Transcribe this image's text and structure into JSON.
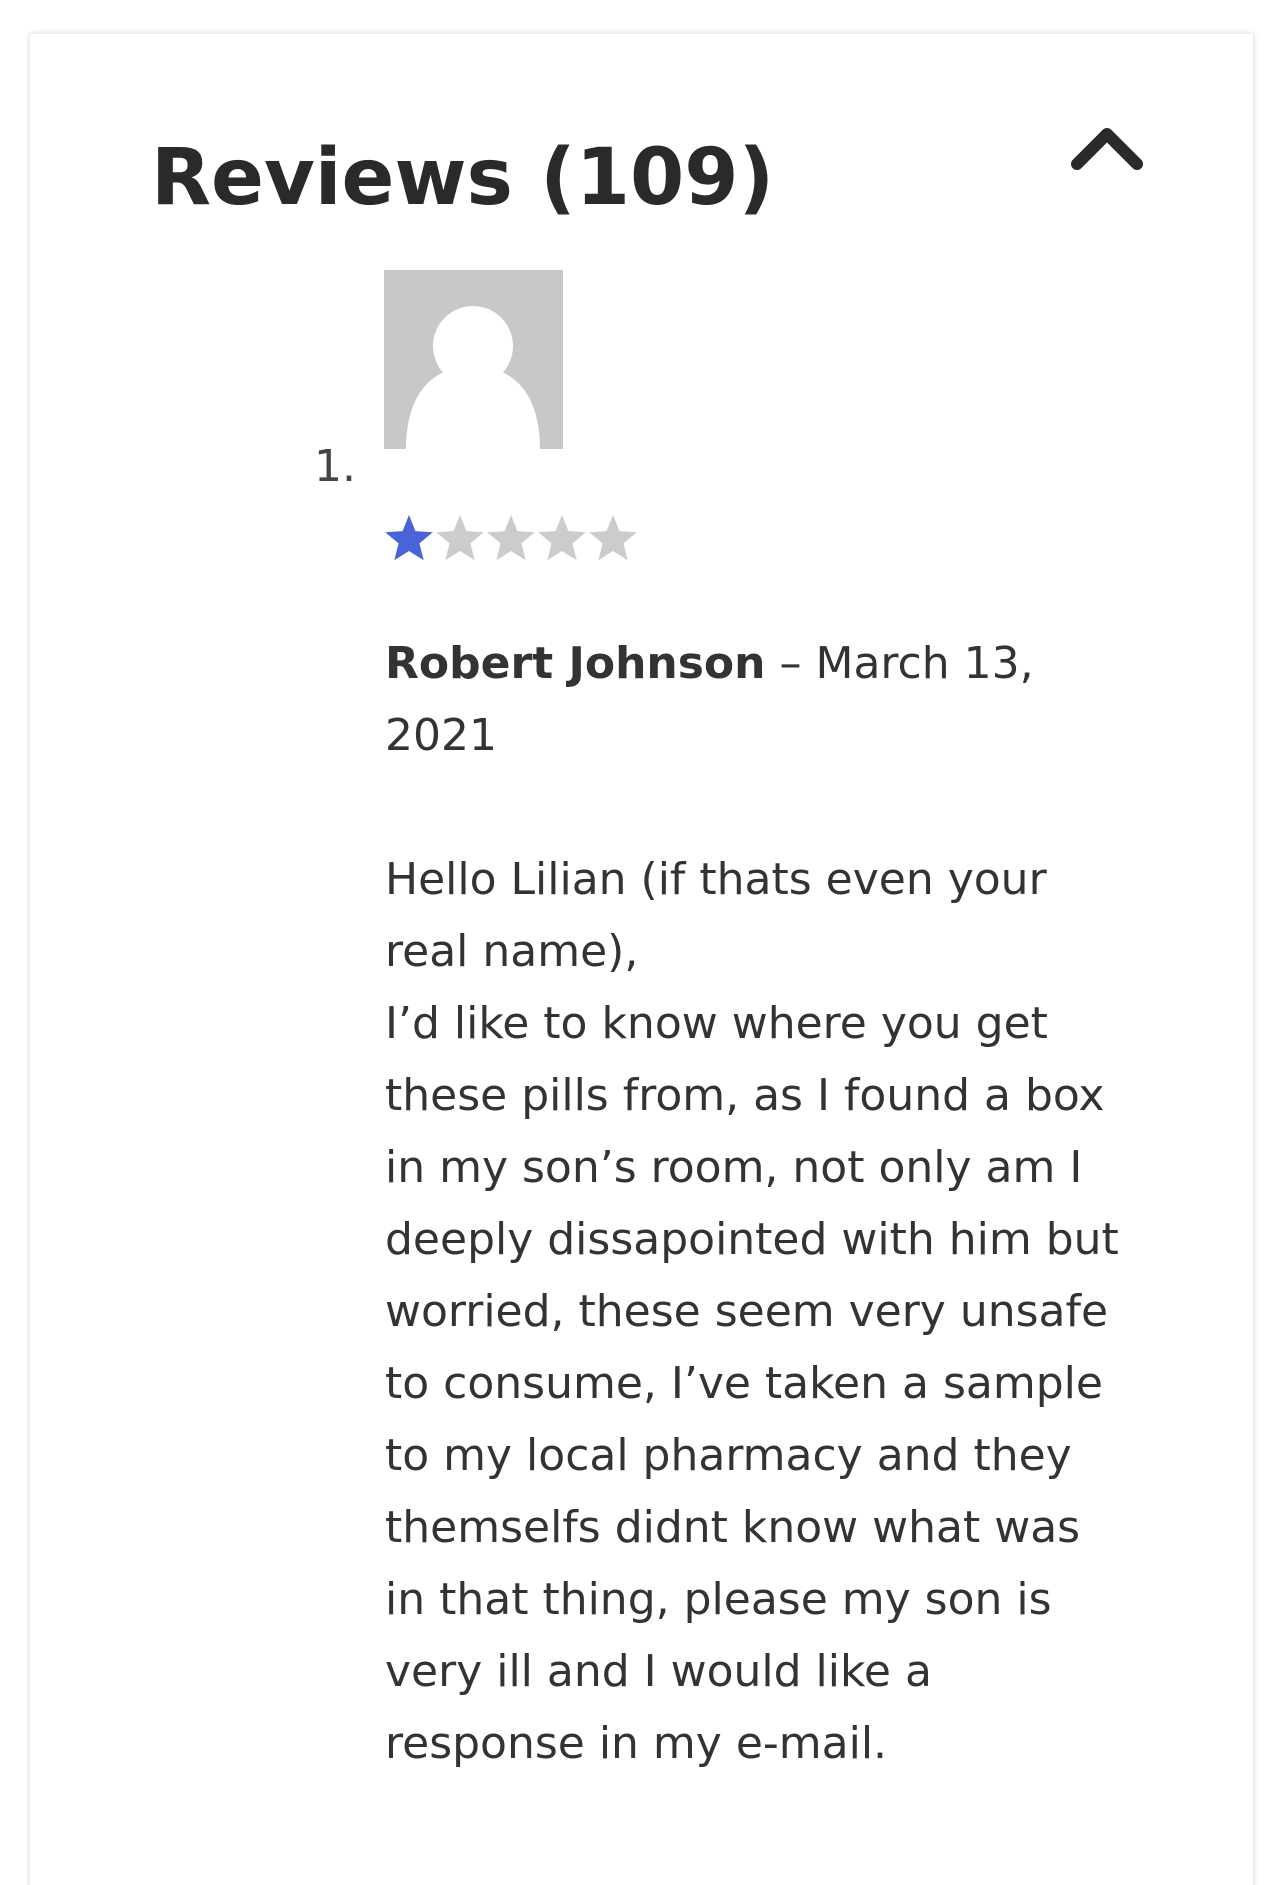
{
  "reviews": {
    "title": "Reviews (109)",
    "collapse_icon": "chevron-up-icon",
    "items": [
      {
        "number": "1.",
        "avatar_icon": "default-avatar-icon",
        "rating": 1,
        "rating_max": 5,
        "star_filled_color": "#4a63d6",
        "star_empty_color": "#cccccc",
        "author": "Robert Johnson",
        "separator": " – ",
        "date": "March 13, 2021",
        "body": "Hello Lilian (if thats even your real name),\nI’d like to know where you get these pills from, as I found a box in my son’s room, not only am I deeply dissapointed with him but worried, these seem very unsafe to consume, I’ve taken a sample to my local pharmacy and they themselfs didnt know what was in that thing, please my son is very ill and I would like a response in my e-mail."
      }
    ]
  }
}
